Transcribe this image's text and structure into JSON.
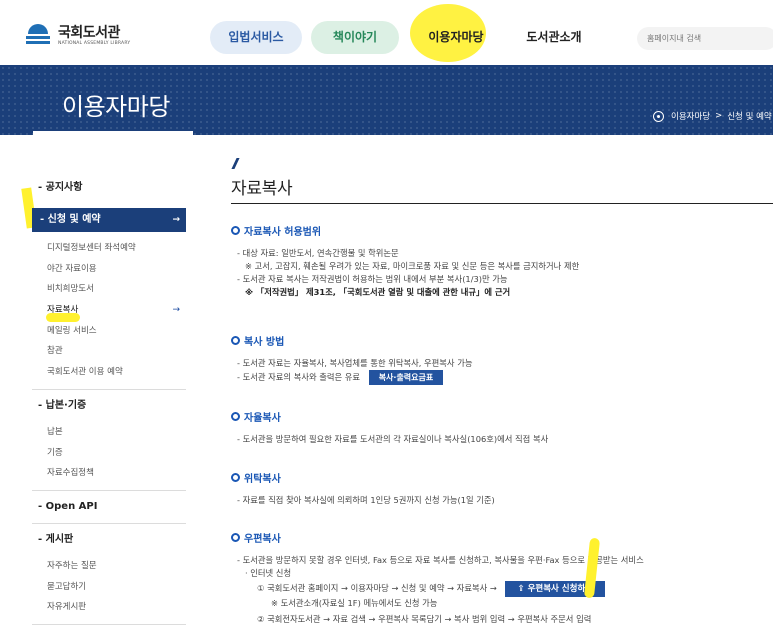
{
  "header": {
    "logo_ko": "국회도서관",
    "logo_en": "NATIONAL ASSEMBLY LIBRARY",
    "nav": [
      "입법서비스",
      "책이야기",
      "이용자마당",
      "도서관소개"
    ],
    "search_placeholder": "홈페이지내 검색"
  },
  "banner": {
    "title": "이용자마당",
    "breadcrumb": [
      "이용자마당",
      "신청 및 예약"
    ],
    "breadcrumb_sep": ">"
  },
  "sidebar": {
    "sections": [
      {
        "head": "공지사항"
      },
      {
        "head": "신청 및 예약",
        "active": true,
        "items": [
          "디지털정보센터 좌석예약",
          "야간 자료이용",
          "비치희망도서",
          "자료복사",
          "메일링 서비스",
          "참관",
          "국회도서관 이용 예약"
        ],
        "current": "자료복사"
      },
      {
        "head": "납본·기증",
        "items": [
          "납본",
          "기증",
          "자료수집정책"
        ]
      },
      {
        "head": "Open API"
      },
      {
        "head": "게시판",
        "items": [
          "자주하는 질문",
          "묻고답하기",
          "자유게시판"
        ]
      }
    ],
    "head_prefix": "-",
    "arrow": "→"
  },
  "content": {
    "title": "자료복사",
    "sections": {
      "allowed": {
        "title": "자료복사 허용범위",
        "lines": [
          "- 대상 자료: 일반도서, 연속간행물 및 학위논문",
          "※ 고서, 고잡지, 훼손될 우려가 있는 자료, 마이크로품 자료 및 신문 등은 복사를 금지하거나 제한",
          "- 도서관 자료 복사는 저작권법이 허용하는 범위 내에서 부분 복사(1/3)만 가능",
          "※ 「저작권법」 제31조, 「국회도서관 열람 및 대출에 관한 내규」에 근거"
        ]
      },
      "method": {
        "title": "복사 방법",
        "lines": [
          "- 도서관 자료는 자율복사, 복사업체를 통한 위탁복사, 우편복사 가능",
          "- 도서관 자료의 복사와 출력은 유료"
        ],
        "button": "복사·출력요금표"
      },
      "self": {
        "title": "자율복사",
        "lines": [
          "- 도서관을 방문하여 필요한 자료를 도서관의 각 자료실이나 복사실(106호)에서 직접 복사"
        ]
      },
      "consign": {
        "title": "위탁복사",
        "lines": [
          "- 자료를 직접 찾아 복사실에 의뢰하며 1인당 5권까지 신청 가능(1일 기준)"
        ]
      },
      "postal": {
        "title": "우편복사",
        "lines": [
          "- 도서관을 방문하지 못할 경우 인터넷, Fax 등으로 자료 복사를 신청하고, 복사물을 우편·Fax 등으로 제공받는 서비스",
          "· 인터넷 신청",
          "① 국회도서관 홈페이지 → 이용자마당 → 신청 및 예약 → 자료복사 →",
          "※ 도서관소개(자료실 1F) 메뉴에서도 신청 가능",
          "② 국회전자도서관 → 자료 검색 → 우편복사 목록담기 → 복사 범위 입력 → 우편복사 주문서 입력"
        ],
        "button": "우편복사 신청하기"
      }
    }
  },
  "colors": {
    "navy": "#1b3f7a",
    "accent_blue": "#1a57b5",
    "highlight": "#fff12e"
  }
}
